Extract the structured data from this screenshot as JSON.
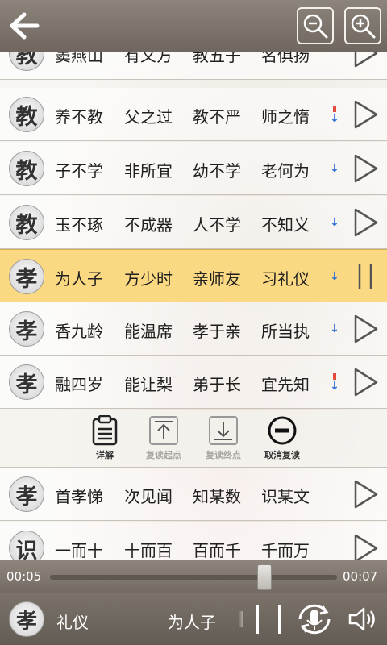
{
  "rows": [
    {
      "badge": "教",
      "phrases": [
        "窦燕山",
        "有义方",
        "教五子",
        "名俱扬"
      ],
      "marker": "",
      "state": "play"
    },
    {
      "badge": "教",
      "phrases": [
        "养不教",
        "父之过",
        "教不严",
        "师之惰"
      ],
      "marker": "red-blue",
      "state": "play"
    },
    {
      "badge": "教",
      "phrases": [
        "子不学",
        "非所宜",
        "幼不学",
        "老何为"
      ],
      "marker": "blue",
      "state": "play"
    },
    {
      "badge": "教",
      "phrases": [
        "玉不琢",
        "不成器",
        "人不学",
        "不知义"
      ],
      "marker": "blue",
      "state": "play"
    },
    {
      "badge": "孝",
      "phrases": [
        "为人子",
        "方少时",
        "亲师友",
        "习礼仪"
      ],
      "marker": "blue",
      "state": "pause"
    },
    {
      "badge": "孝",
      "phrases": [
        "香九龄",
        "能温席",
        "孝于亲",
        "所当执"
      ],
      "marker": "blue",
      "state": "play"
    },
    {
      "badge": "孝",
      "phrases": [
        "融四岁",
        "能让梨",
        "弟于长",
        "宜先知"
      ],
      "marker": "red-blue",
      "state": "play"
    },
    {
      "badge": "孝",
      "phrases": [
        "首孝悌",
        "次见闻",
        "知某数",
        "识某文"
      ],
      "marker": "",
      "state": "play"
    },
    {
      "badge": "识",
      "phrases": [
        "一而十",
        "十而百",
        "百而千",
        "千而万"
      ],
      "marker": "",
      "state": "play"
    }
  ],
  "actions": {
    "detail": "详解",
    "repeat_start": "复读起点",
    "repeat_end": "复读终点",
    "cancel_repeat": "取消复读"
  },
  "progress": {
    "current": "00:05",
    "duration": "00:07",
    "fraction": 0.71
  },
  "player": {
    "badge": "孝",
    "previous_text": "礼仪",
    "current_text": "为人子"
  },
  "colors": {
    "active_row": "#fbd983",
    "marker_red": "#e14a3c",
    "marker_blue": "#2c6bd6",
    "bar": "#7b736a"
  },
  "icons": {
    "back": "arrow-left-icon",
    "zoom_out": "zoom-out-icon",
    "zoom_in": "zoom-in-icon",
    "play": "play-icon",
    "pause": "pause-icon",
    "detail": "clipboard-icon",
    "repeat_start": "upload-icon",
    "repeat_end": "download-icon",
    "cancel": "minus-circle-icon",
    "mic": "mic-repeat-icon",
    "volume": "speaker-icon"
  }
}
